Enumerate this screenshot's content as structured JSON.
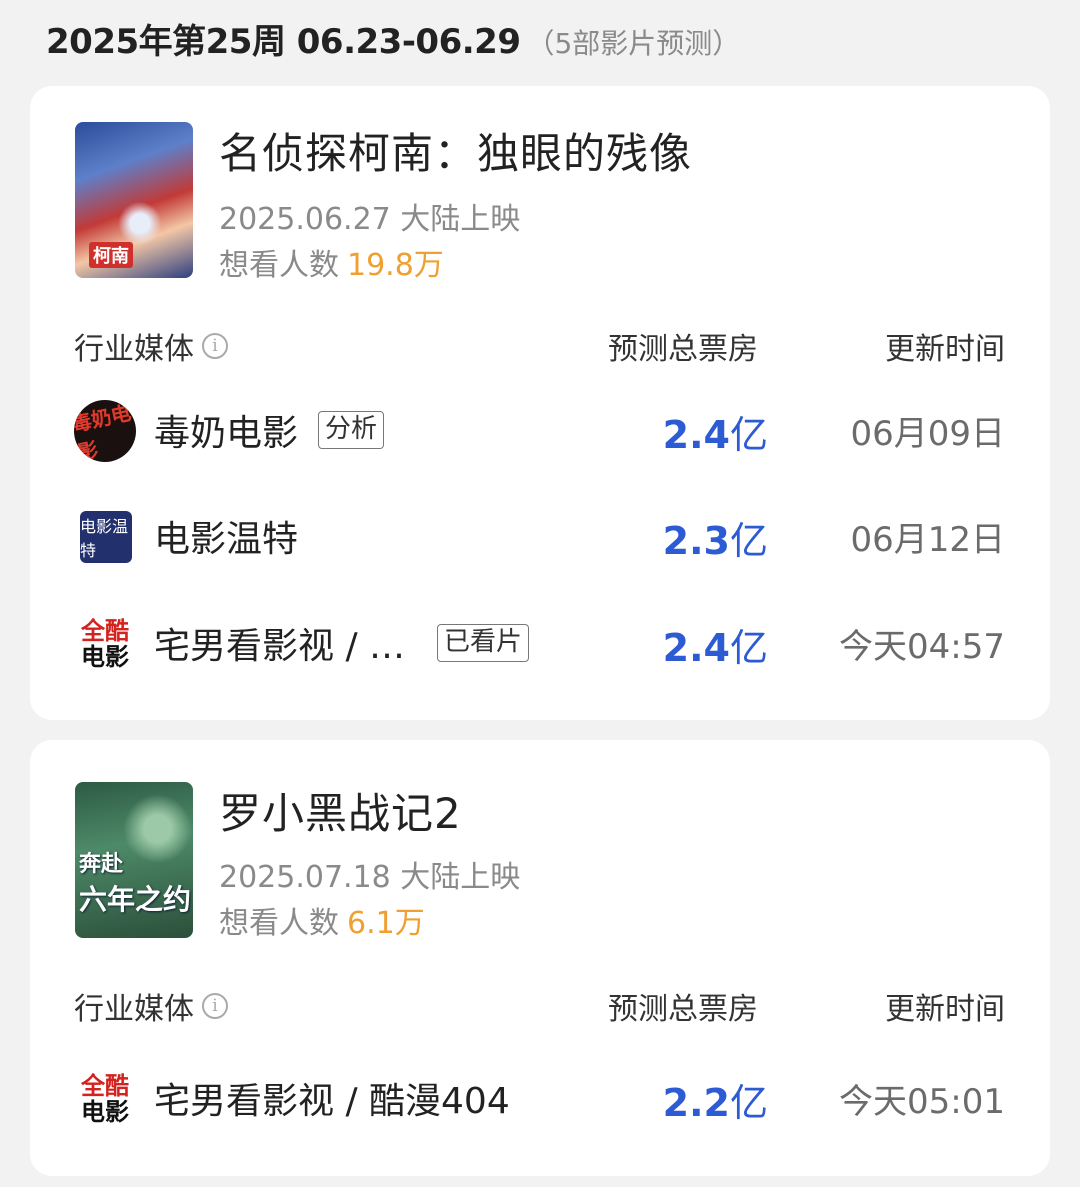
{
  "week": {
    "title": "2025年第25周 06.23-06.29",
    "count_note": "（5部影片预测）"
  },
  "columns": {
    "media": "行业媒体",
    "info_icon": "i",
    "box_office": "预测总票房",
    "update_time": "更新时间"
  },
  "movies": [
    {
      "title": "名侦探柯南：独眼的残像",
      "release": "2025.06.27 大陆上映",
      "want_label": "想看人数",
      "want_count": "19.8万",
      "poster_text": "柯南",
      "predictions": [
        {
          "logo_icon": "dunai-movie-logo-icon",
          "logo_text": "毒奶电影",
          "name": "毒奶电影",
          "tag": "分析",
          "value": "2.4",
          "unit": "亿",
          "time": "06月09日"
        },
        {
          "logo_icon": "movie-wente-logo-icon",
          "logo_text": "电影温特",
          "name": "电影温特",
          "tag": "",
          "value": "2.3",
          "unit": "亿",
          "time": "06月12日"
        },
        {
          "logo_icon": "kumang-movie-logo-icon",
          "logo_text_1": "全酷",
          "logo_text_2": "电影",
          "name": "宅男看影视 / …",
          "tag": "已看片",
          "value": "2.4",
          "unit": "亿",
          "time": "今天04:57"
        }
      ]
    },
    {
      "title": "罗小黑战记2",
      "release": "2025.07.18 大陆上映",
      "want_label": "想看人数",
      "want_count": "6.1万",
      "poster_line_1": "奔赴",
      "poster_line_2": "六年之约",
      "predictions": [
        {
          "logo_icon": "kumang-movie-logo-icon",
          "logo_text_1": "全酷",
          "logo_text_2": "电影",
          "name": "宅男看影视 / 酷漫404",
          "tag": "",
          "value": "2.2",
          "unit": "亿",
          "time": "今天05:01"
        }
      ]
    }
  ],
  "colors": {
    "box_office_blue": "#2d5bd3",
    "want_count_orange": "#f0a030",
    "muted_gray": "#8a8a8a"
  }
}
